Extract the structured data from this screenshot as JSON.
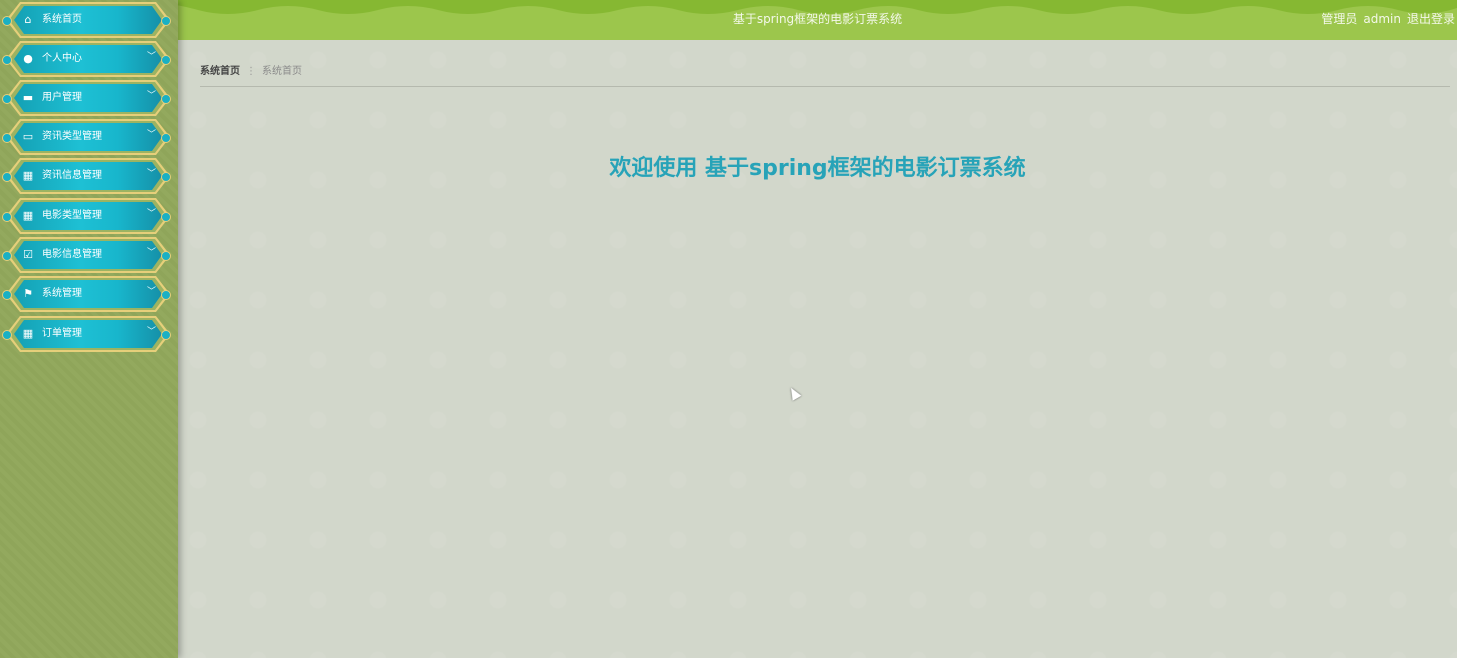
{
  "header": {
    "title": "基于spring框架的电影订票系统",
    "role_label": "管理员",
    "username": "admin",
    "logout_label": "退出登录"
  },
  "sidebar": {
    "items": [
      {
        "label": "系统首页",
        "icon": "home-icon",
        "glyph": "⌂",
        "has_chevron": false
      },
      {
        "label": "个人中心",
        "icon": "user-icon",
        "glyph": "●",
        "has_chevron": true
      },
      {
        "label": "用户管理",
        "icon": "briefcase-icon",
        "glyph": "▬",
        "has_chevron": true
      },
      {
        "label": "资讯类型管理",
        "icon": "monitor-icon",
        "glyph": "▭",
        "has_chevron": true
      },
      {
        "label": "资讯信息管理",
        "icon": "grid-icon",
        "glyph": "▦",
        "has_chevron": true
      },
      {
        "label": "电影类型管理",
        "icon": "grid-icon",
        "glyph": "▦",
        "has_chevron": true
      },
      {
        "label": "电影信息管理",
        "icon": "clipboard-check-icon",
        "glyph": "☑",
        "has_chevron": true
      },
      {
        "label": "系统管理",
        "icon": "flag-icon",
        "glyph": "⚑",
        "has_chevron": true
      },
      {
        "label": "订单管理",
        "icon": "grid-icon",
        "glyph": "▦",
        "has_chevron": true
      }
    ],
    "chevron_glyph": "﹀"
  },
  "breadcrumb": {
    "root": "系统首页",
    "separator": "⋮",
    "current": "系统首页"
  },
  "main": {
    "welcome": "欢迎使用 基于spring框架的电影订票系统"
  },
  "colors": {
    "accent": "#27a3b8",
    "header_bg": "#9cc64c",
    "sidebar_bg": "#8fa55a",
    "menu_item": "#1ec0d4",
    "menu_border": "#e6cf7a"
  }
}
